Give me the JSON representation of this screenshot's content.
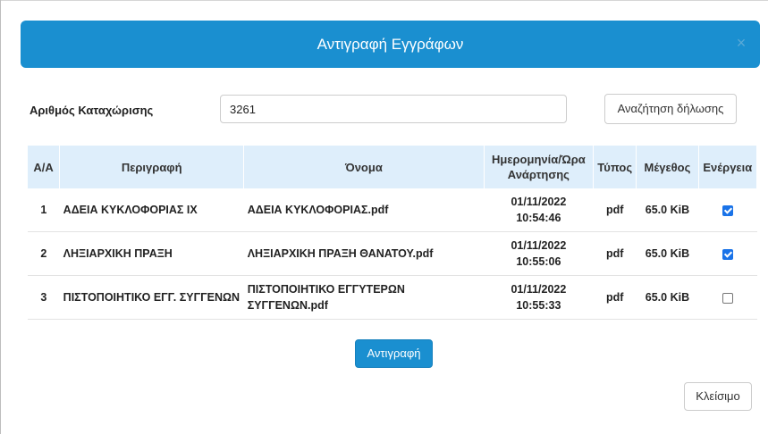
{
  "modal": {
    "title": "Αντιγραφή Εγγράφων",
    "close_glyph": "×"
  },
  "form": {
    "registration_label": "Αριθμός Καταχώρισης",
    "registration_value": "3261",
    "search_button": "Αναζήτηση δήλωσης"
  },
  "table": {
    "headers": [
      "Α/Α",
      "Περιγραφή",
      "Όνομα",
      "Ημερομηνία/Ώρα Ανάρτησης",
      "Τύπος",
      "Μέγεθος",
      "Ενέργεια"
    ],
    "rows": [
      {
        "index": "1",
        "description": "ΑΔΕΙΑ ΚΥΚΛΟΦΟΡΙΑΣ ΙΧ",
        "name": "ΑΔΕΙΑ ΚΥΚΛΟΦΟΡΙΑΣ.pdf",
        "date": "01/11/2022",
        "time": "10:54:46",
        "type": "pdf",
        "size": "65.0 KiB",
        "checked": true
      },
      {
        "index": "2",
        "description": "ΛΗΞΙΑΡΧΙΚΗ ΠΡΑΞΗ",
        "name": "ΛΗΞΙΑΡΧΙΚΗ ΠΡΑΞΗ ΘΑΝΑΤΟΥ.pdf",
        "date": "01/11/2022",
        "time": "10:55:06",
        "type": "pdf",
        "size": "65.0 KiB",
        "checked": true
      },
      {
        "index": "3",
        "description": "ΠΙΣΤΟΠΟΙΗΤΙΚΟ ΕΓΓ. ΣΥΓΓΕΝΩΝ",
        "name": "ΠΙΣΤΟΠΟΙΗΤΙΚΟ ΕΓΓΥΤΕΡΩΝ ΣΥΓΓΕΝΩΝ.pdf",
        "date": "01/11/2022",
        "time": "10:55:33",
        "type": "pdf",
        "size": "65.0 KiB",
        "checked": false
      }
    ]
  },
  "actions": {
    "copy_button": "Αντιγραφή",
    "close_button": "Κλείσιμο"
  },
  "colors": {
    "header_blue": "#1a8fd0",
    "table_header_bg": "#deeefb",
    "checkbox_blue": "#1a73e8"
  },
  "icons": {
    "close": "close-icon",
    "checkbox_checked": "checkbox-checked-icon",
    "checkbox_unchecked": "checkbox-unchecked-icon"
  }
}
